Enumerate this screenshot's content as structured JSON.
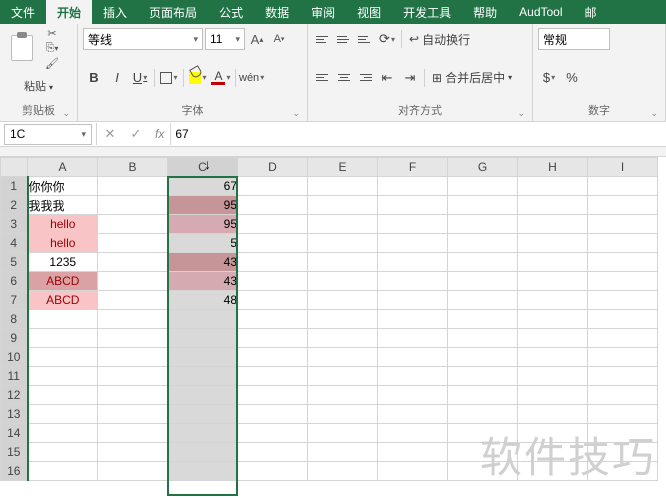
{
  "tabs": [
    "文件",
    "开始",
    "插入",
    "页面布局",
    "公式",
    "数据",
    "审阅",
    "视图",
    "开发工具",
    "帮助",
    "AudTool",
    "邮"
  ],
  "activeTab": 1,
  "clipboard": {
    "paste": "粘贴",
    "label": "剪贴板"
  },
  "font": {
    "name": "等线",
    "size": "11",
    "label": "字体",
    "bold": "B",
    "italic": "I",
    "underline": "U"
  },
  "align": {
    "wrap": "自动换行",
    "merge": "合并后居中",
    "label": "对齐方式"
  },
  "number": {
    "format": "常规",
    "label": "数字"
  },
  "namebox": "1C",
  "formula": "67",
  "cols": [
    "A",
    "B",
    "C",
    "D",
    "E",
    "F",
    "G",
    "H",
    "I"
  ],
  "rows": [
    1,
    2,
    3,
    4,
    5,
    6,
    7,
    8,
    9,
    10,
    11,
    12,
    13,
    14,
    15,
    16
  ],
  "cellsA": [
    "你你你",
    "我我我",
    "hello",
    "hello",
    "1235",
    "ABCD",
    "ABCD"
  ],
  "cellsC": [
    "67",
    "95",
    "95",
    "5",
    "43",
    "43",
    "48"
  ],
  "watermark": "软件技巧"
}
